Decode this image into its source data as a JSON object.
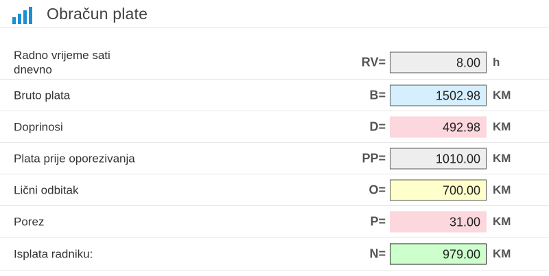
{
  "header": {
    "title": "Obračun plate",
    "icon": "bar-chart-icon",
    "icon_color": "#1a8fd6"
  },
  "rows": [
    {
      "label": "Radno vrijeme sati dnevno",
      "symbol": "RV=",
      "value": "8.00",
      "unit": "h",
      "color": "gray"
    },
    {
      "label": "Bruto plata",
      "symbol": "B=",
      "value": "1502.98",
      "unit": "KM",
      "color": "blue"
    },
    {
      "label": "Doprinosi",
      "symbol": "D=",
      "value": "492.98",
      "unit": "KM",
      "color": "pink"
    },
    {
      "label": "Plata prije oporezivanja",
      "symbol": "PP=",
      "value": "1010.00",
      "unit": "KM",
      "color": "gray"
    },
    {
      "label": "Lični odbitak",
      "symbol": "O=",
      "value": "700.00",
      "unit": "KM",
      "color": "yellow"
    },
    {
      "label": "Porez",
      "symbol": "P=",
      "value": "31.00",
      "unit": "KM",
      "color": "pink"
    },
    {
      "label": "Isplata radniku:",
      "symbol": "N=",
      "value": "979.00",
      "unit": "KM",
      "color": "green"
    }
  ]
}
